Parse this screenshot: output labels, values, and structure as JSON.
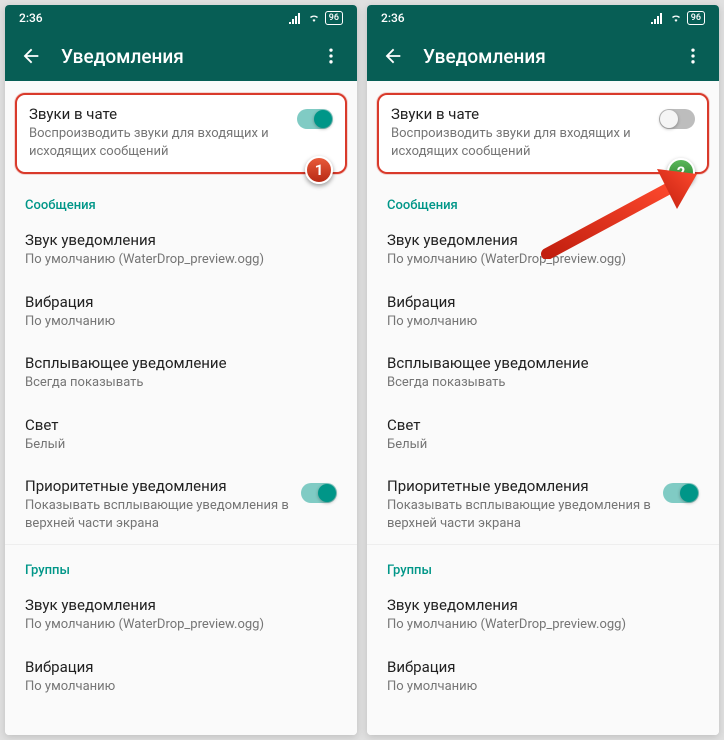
{
  "status": {
    "time": "2:36",
    "battery": "96"
  },
  "appbar": {
    "title": "Уведомления"
  },
  "card": {
    "title": "Звуки в чате",
    "sub": "Воспроизводить звуки для входящих и исходящих сообщений"
  },
  "sections": {
    "messages": {
      "header": "Сообщения"
    },
    "groups": {
      "header": "Группы"
    }
  },
  "rows": {
    "sound": {
      "title": "Звук уведомления",
      "sub": "По умолчанию (WaterDrop_preview.ogg)"
    },
    "vibr": {
      "title": "Вибрация",
      "sub": "По умолчанию"
    },
    "popup": {
      "title": "Всплывающее уведомление",
      "sub": "Всегда показывать"
    },
    "light": {
      "title": "Свет",
      "sub": "Белый"
    },
    "prio": {
      "title": "Приоритетные уведомления",
      "sub": "Показывать всплывающие уведомления в верхней части экрана"
    },
    "gsound": {
      "title": "Звук уведомления",
      "sub": "По умолчанию (WaterDrop_preview.ogg)"
    },
    "gvibr": {
      "title": "Вибрация",
      "sub": "По умолчанию"
    }
  },
  "badges": {
    "one": "1",
    "two": "2"
  }
}
